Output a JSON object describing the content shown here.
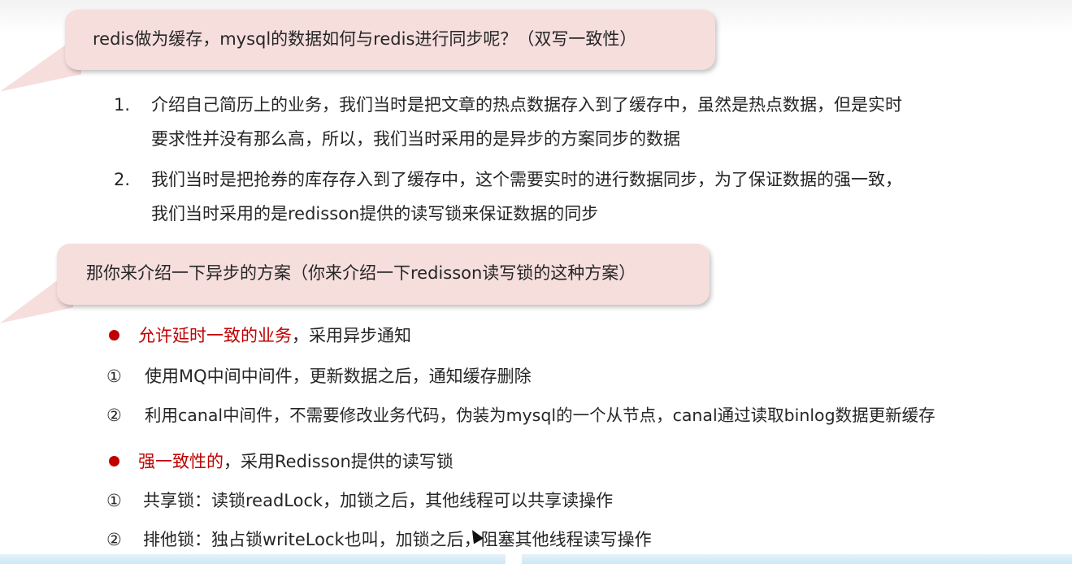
{
  "question_1": "redis做为缓存，mysql的数据如何与redis进行同步呢？（双写一致性）",
  "answers": [
    {
      "number": "1.",
      "line_1": "介绍自己简历上的业务，我们当时是把文章的热点数据存入到了缓存中，虽然是热点数据，但是实时",
      "line_2": "要求性并没有那么高，所以，我们当时采用的是异步的方案同步的数据"
    },
    {
      "number": "2.",
      "line_1": "我们当时是把抢券的库存存入到了缓存中，这个需要实时的进行数据同步，为了保证数据的强一致，",
      "line_2": "我们当时采用的是redisson提供的读写锁来保证数据的同步"
    }
  ],
  "question_2": "那你来介绍一下异步的方案（你来介绍一下redisson读写锁的这种方案）",
  "section_async": {
    "highlight": "允许延时一致的业务",
    "rest": "，采用异步通知",
    "items": [
      {
        "marker": "①",
        "text": "使用MQ中间中间件，更新数据之后，通知缓存删除"
      },
      {
        "marker": "②",
        "text": "利用canal中间件，不需要修改业务代码，伪装为mysql的一个从节点，canal通过读取binlog数据更新缓存"
      }
    ]
  },
  "section_strong": {
    "highlight": "强一致性的",
    "rest": "，采用Redisson提供的读写锁",
    "items": [
      {
        "marker": "①",
        "text": "共享锁：读锁readLock，加锁之后，其他线程可以共享读操作"
      },
      {
        "marker": "②",
        "text": "排他锁：独占锁writeLock也叫，加锁之后，阻塞其他线程读写操作"
      }
    ]
  },
  "colors": {
    "bubble": "#f6dedd",
    "accent_red": "#c00000",
    "text": "#262626"
  }
}
